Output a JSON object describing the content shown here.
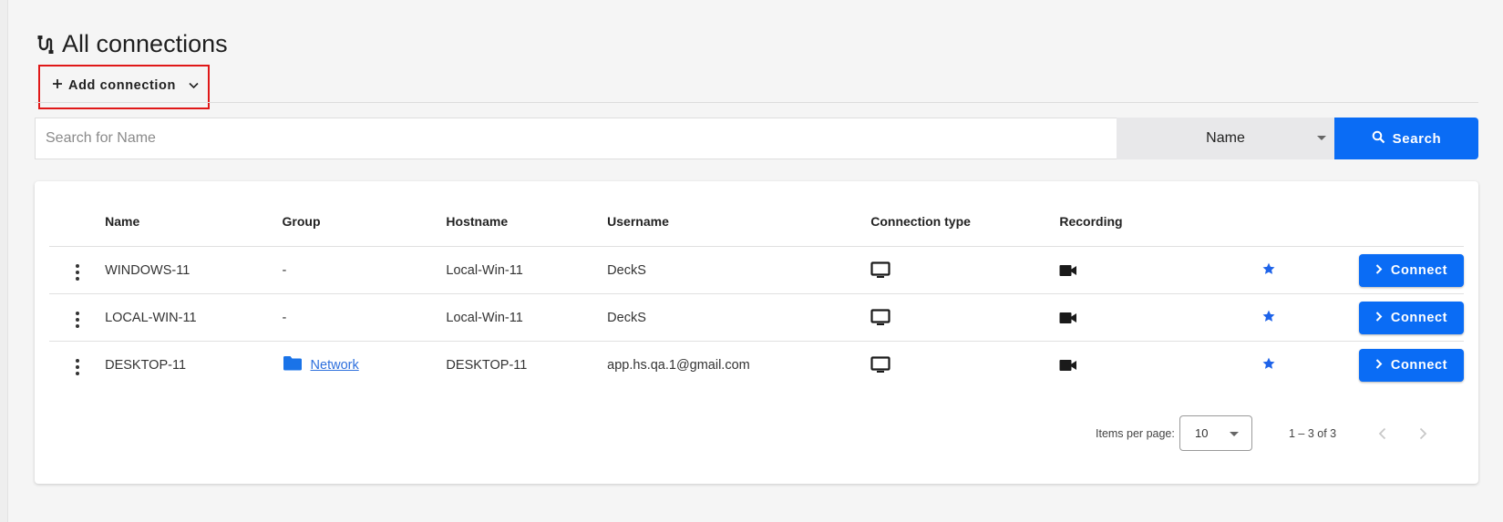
{
  "page": {
    "title": "All connections"
  },
  "toolbar": {
    "add_label": "Add connection"
  },
  "search": {
    "placeholder": "Search for Name",
    "field_selected": "Name",
    "button_label": "Search"
  },
  "table": {
    "columns": [
      "Name",
      "Group",
      "Hostname",
      "Username",
      "Connection type",
      "Recording"
    ],
    "rows": [
      {
        "name": "WINDOWS-11",
        "group": "-",
        "hostname": "Local-Win-11",
        "username": "DeckS",
        "connection_icon": "monitor-icon",
        "recording_icon": "video-camera-icon",
        "favorite_icon": "star-icon",
        "action": "Connect"
      },
      {
        "name": "LOCAL-WIN-11",
        "group": "-",
        "hostname": "Local-Win-11",
        "username": "DeckS",
        "connection_icon": "monitor-icon",
        "recording_icon": "video-camera-icon",
        "favorite_icon": "star-icon",
        "action": "Connect"
      },
      {
        "name": "DESKTOP-11",
        "group": "Network",
        "group_icon": "folder-icon",
        "hostname": "DESKTOP-11",
        "username": "app.hs.qa.1@gmail.com",
        "connection_icon": "monitor-icon",
        "recording_icon": "video-camera-icon",
        "favorite_icon": "star-icon",
        "action": "Connect"
      }
    ]
  },
  "pagination": {
    "items_per_page_label": "Items per page:",
    "items_per_page": "10",
    "range": "1 – 3 of 3"
  },
  "colors": {
    "primary": "#0a6cf5",
    "star": "#1e63e9",
    "folder": "#1a73e8",
    "highlight": "#e01818"
  }
}
